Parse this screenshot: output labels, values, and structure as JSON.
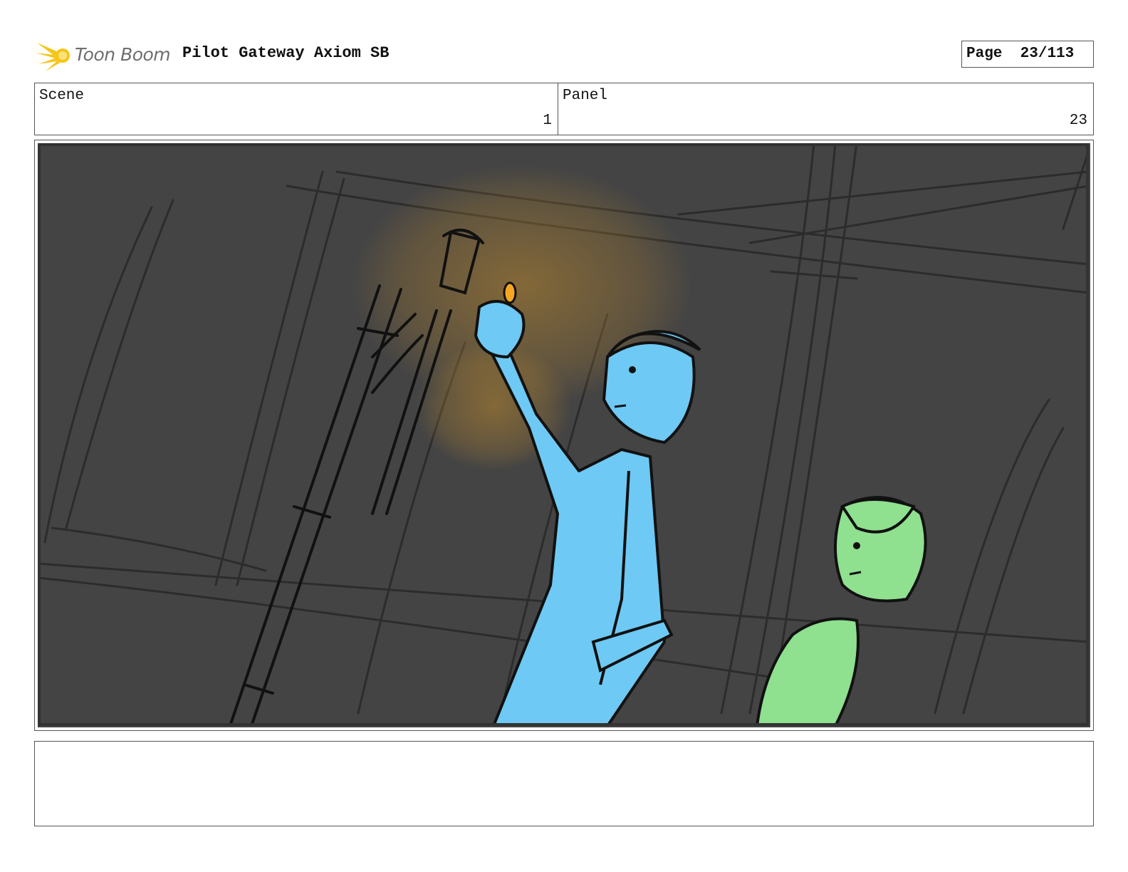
{
  "header": {
    "logo_text": "Toon Boom",
    "title": "Pilot Gateway Axiom SB",
    "page_label": "Page",
    "page_value": "23/113"
  },
  "info": {
    "scene_label": "Scene",
    "scene_value": "1",
    "panel_label": "Panel",
    "panel_value": "23"
  },
  "frame": {
    "background_color": "#444444",
    "line_color": "#2a2a2a",
    "ink_color": "#111111",
    "character_1_color": "#6ec9f4",
    "character_2_color": "#8fe08f",
    "glow_color": "#b8862e",
    "flame_color": "#f5a623"
  },
  "notes": {
    "text": ""
  }
}
